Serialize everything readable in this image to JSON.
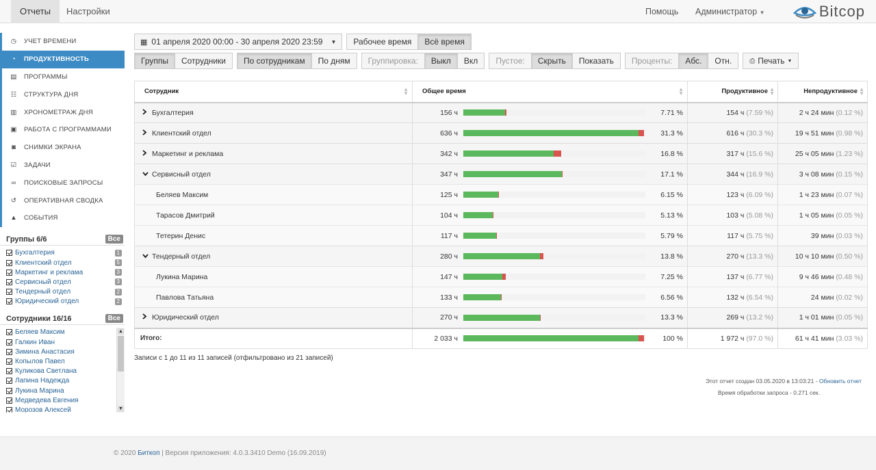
{
  "nav": {
    "tab_reports": "Отчеты",
    "tab_settings": "Настройки",
    "help": "Помощь",
    "admin": "Администратор",
    "brand": "Bitcop"
  },
  "menu": [
    {
      "label": "Учет времени",
      "icon": "clock-icon",
      "active": false
    },
    {
      "label": "Продуктивность",
      "icon": "productivity-icon",
      "active": true
    },
    {
      "label": "Программы",
      "icon": "programs-icon",
      "active": false
    },
    {
      "label": "Структура дня",
      "icon": "day-structure-icon",
      "active": false
    },
    {
      "label": "Хронометраж дня",
      "icon": "film-icon",
      "active": false
    },
    {
      "label": "Работа с программами",
      "icon": "app-usage-icon",
      "active": false
    },
    {
      "label": "Снимки экрана",
      "icon": "camera-icon",
      "active": false
    },
    {
      "label": "Задачи",
      "icon": "tasks-icon",
      "active": false
    },
    {
      "label": "Поисковые запросы",
      "icon": "binoculars-icon",
      "active": false
    },
    {
      "label": "Оперативная сводка",
      "icon": "history-icon",
      "active": false
    },
    {
      "label": "События",
      "icon": "bell-icon",
      "active": false
    }
  ],
  "groups": {
    "title": "Группы 6/6",
    "all": "Все",
    "items": [
      {
        "label": "Бухгалтерия",
        "count": "1"
      },
      {
        "label": "Клиентский отдел",
        "count": "5"
      },
      {
        "label": "Маркетинг и реклама",
        "count": "3"
      },
      {
        "label": "Сервисный отдел",
        "count": "3"
      },
      {
        "label": "Тендерный отдел",
        "count": "2"
      },
      {
        "label": "Юридический отдел",
        "count": "2"
      }
    ]
  },
  "employees": {
    "title": "Сотрудники 16/16",
    "all": "Все",
    "items": [
      "Беляев Максим",
      "Галкин Иван",
      "Зимина Анастасия",
      "Копылов Павел",
      "Куликова Светлана",
      "Лапина Надежда",
      "Лукина Марина",
      "Медведева Евгения",
      "Морозов Алексей"
    ]
  },
  "toolbar": {
    "date_range": "01 апреля 2020 00:00 - 30 апреля 2020 23:59",
    "work_time": "Рабочее время",
    "all_time": "Всё время",
    "groups": "Группы",
    "employees": "Сотрудники",
    "by_employee": "По сотрудникам",
    "by_day": "По дням",
    "grouping": "Группировка:",
    "off": "Выкл",
    "on": "Вкл",
    "empty": "Пустое:",
    "hide": "Скрыть",
    "show": "Показать",
    "percents": "Проценты:",
    "abs": "Абс.",
    "rel": "Отн.",
    "print": "Печать"
  },
  "table": {
    "headers": {
      "employee": "Сотрудник",
      "total": "Общее время",
      "productive": "Продуктивное",
      "unproductive": "Непродуктивное"
    },
    "rows": [
      {
        "type": "group",
        "arrow": "›",
        "name": "Бухгалтерия",
        "hours": "156 ч",
        "green": 23,
        "red": 0.5,
        "pct": "7.71 %",
        "prod": "154 ч",
        "prod_pct": "(7.59 %)",
        "unprod": "2 ч 24 мин",
        "unprod_pct": "(0.12 %)"
      },
      {
        "type": "group",
        "arrow": "›",
        "name": "Клиентский отдел",
        "hours": "636 ч",
        "green": 96.2,
        "red": 3,
        "pct": "31.3 %",
        "prod": "616 ч",
        "prod_pct": "(30.3 %)",
        "unprod": "19 ч 51 мин",
        "unprod_pct": "(0.98 %)"
      },
      {
        "type": "group",
        "arrow": "›",
        "name": "Маркетинг и реклама",
        "hours": "342 ч",
        "green": 49.8,
        "red": 3.9,
        "pct": "16.8 %",
        "prod": "317 ч",
        "prod_pct": "(15.6 %)",
        "unprod": "25 ч 05 мин",
        "unprod_pct": "(1.23 %)"
      },
      {
        "type": "group",
        "arrow": "⌄",
        "name": "Сервисный отдел",
        "hours": "347 ч",
        "green": 54,
        "red": 0.5,
        "pct": "17.1 %",
        "prod": "344 ч",
        "prod_pct": "(16.9 %)",
        "unprod": "3 ч 08 мин",
        "unprod_pct": "(0.15 %)"
      },
      {
        "type": "emp",
        "name": "Беляев Максим",
        "hours": "125 ч",
        "green": 19.3,
        "red": 0.4,
        "pct": "6.15 %",
        "prod": "123 ч",
        "prod_pct": "(6.09 %)",
        "unprod": "1 ч 23 мин",
        "unprod_pct": "(0.07 %)"
      },
      {
        "type": "emp",
        "name": "Тарасов Дмитрий",
        "hours": "104 ч",
        "green": 16,
        "red": 0.4,
        "pct": "5.13 %",
        "prod": "103 ч",
        "prod_pct": "(5.08 %)",
        "unprod": "1 ч 05 мин",
        "unprod_pct": "(0.05 %)"
      },
      {
        "type": "emp",
        "name": "Тетерин Денис",
        "hours": "117 ч",
        "green": 18.2,
        "red": 0.3,
        "pct": "5.79 %",
        "prod": "117 ч",
        "prod_pct": "(5.75 %)",
        "unprod": "39 мин",
        "unprod_pct": "(0.03 %)"
      },
      {
        "type": "group",
        "arrow": "⌄",
        "name": "Тендерный отдел",
        "hours": "280 ч",
        "green": 42.2,
        "red": 1.7,
        "pct": "13.8 %",
        "prod": "270 ч",
        "prod_pct": "(13.3 %)",
        "unprod": "10 ч 10 мин",
        "unprod_pct": "(0.50 %)"
      },
      {
        "type": "emp",
        "name": "Лукина Марина",
        "hours": "147 ч",
        "green": 21.6,
        "red": 1.6,
        "pct": "7.25 %",
        "prod": "137 ч",
        "prod_pct": "(6.77 %)",
        "unprod": "9 ч 46 мин",
        "unprod_pct": "(0.48 %)"
      },
      {
        "type": "emp",
        "name": "Павлова Татьяна",
        "hours": "133 ч",
        "green": 20.8,
        "red": 0.2,
        "pct": "6.56 %",
        "prod": "132 ч",
        "prod_pct": "(6.54 %)",
        "unprod": "24 мин",
        "unprod_pct": "(0.02 %)"
      },
      {
        "type": "group",
        "arrow": "›",
        "name": "Юридический отдел",
        "hours": "270 ч",
        "green": 42.1,
        "red": 0.5,
        "pct": "13.3 %",
        "prod": "269 ч",
        "prod_pct": "(13.2 %)",
        "unprod": "1 ч 01 мин",
        "unprod_pct": "(0.05 %)"
      }
    ],
    "total": {
      "name": "Итого:",
      "hours": "2 033 ч",
      "green": 96.2,
      "red": 3,
      "pct": "100 %",
      "prod": "1 972 ч",
      "prod_pct": "(97.0 %)",
      "unprod": "61 ч 41 мин",
      "unprod_pct": "(3.03 %)"
    }
  },
  "info": "Записи с 1 до 11 из 11 записей (отфильтровано из 21 записей)",
  "meta": {
    "created": "Этот отчет создан 03.05.2020 в 13:03:21 - ",
    "refresh": "Обновить отчет",
    "processing": "Время обработки запроса - 0.271 сек."
  },
  "footer": {
    "copy": "© 2020 ",
    "brand": "Биткоп",
    "version": " | Версия приложения: 4.0.3.3410 Demo (16.09.2019)"
  },
  "colors": {
    "accent": "#3d8bc4",
    "productive": "#5cb85c",
    "unproductive": "#d9534f"
  }
}
